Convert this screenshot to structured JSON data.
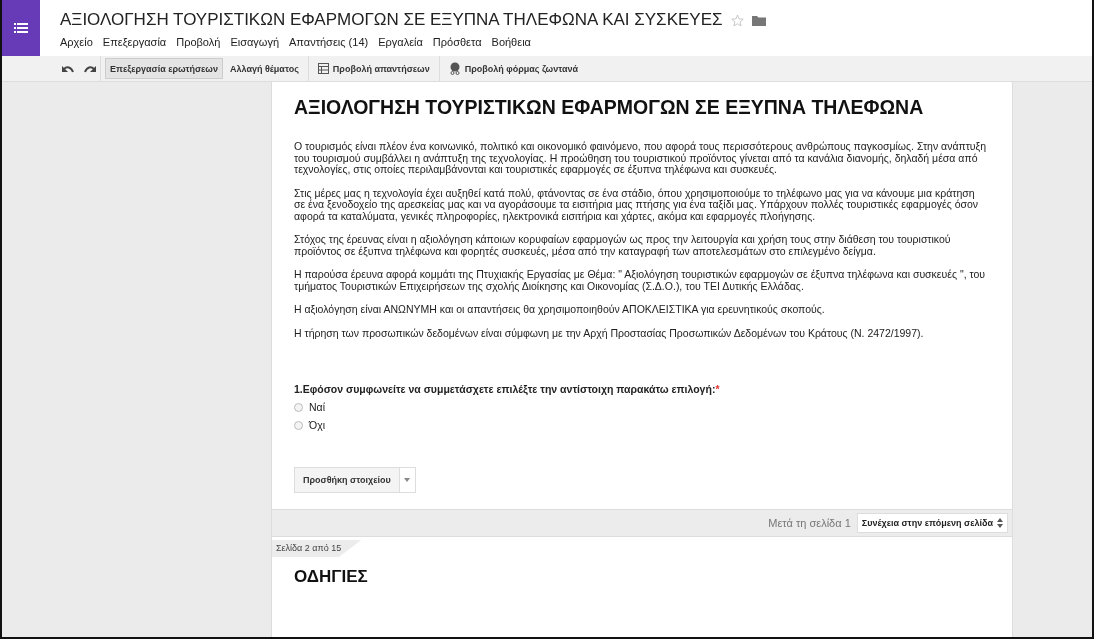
{
  "document": {
    "title": "ΑΞΙΟΛΟΓΗΣΗ ΤΟΥΡΙΣΤΙΚΩΝ ΕΦΑΡΜΟΓΩΝ ΣΕ ΕΞΥΠΝΑ ΤΗΛΕΦΩΝΑ ΚΑΙ ΣΥΣΚΕΥΕΣ",
    "starred": false
  },
  "menu": [
    "Αρχείο",
    "Επεξεργασία",
    "Προβολή",
    "Εισαγωγή",
    "Απαντήσεις (14)",
    "Εργαλεία",
    "Πρόσθετα",
    "Βοήθεια"
  ],
  "toolbar": [
    {
      "kind": "toggle",
      "label": "Επεξεργασία ερωτήσεων",
      "selected": true
    },
    {
      "kind": "toggle",
      "label": "Αλλαγή θέματος",
      "selected": false
    },
    {
      "kind": "table",
      "label": "Προβολή απαντήσεων",
      "selected": false
    },
    {
      "kind": "live",
      "label": "Προβολή φόρμας ζωντανά",
      "selected": false
    }
  ],
  "form": {
    "heading": "ΑΞΙΟΛΟΓΗΣΗ ΤΟΥΡΙΣΤΙΚΩΝ ΕΦΑΡΜΟΓΩΝ ΣΕ ΕΞΥΠΝΑ ΤΗΛΕΦΩΝΑ",
    "paragraphs": [
      "Ο τουρισμός είναι πλέον ένα κοινωνικό, πολιτικό και οικονομικό φαινόμενο, που αφορά τους περισσότερους ανθρώπους παγκοσμίως. Στην ανάπτυξη του τουρισμού συμβάλλει η ανάπτυξη της τεχνολογίας. Η προώθηση του τουριστικού προϊόντος γίνεται από τα κανάλια διανομής, δηλαδή μέσα από τεχνολογίες, στις οποίες περιλαμβάνονται και τουριστικές εφαρμογές σε έξυπνα τηλέφωνα και συσκευές.",
      "Στις μέρες μας η τεχνολογία έχει αυξηθεί κατά πολύ, φτάνοντας σε ένα στάδιο, όπου χρησιμοποιούμε το τηλέφωνο μας για να κάνουμε μια κράτηση σε ένα ξενοδοχείο της αρεσκείας μας και να αγοράσουμε τα εισιτήρια μας πτήσης για ένα ταξίδι μας. Υπάρχουν πολλές τουριστικές εφαρμογές όσον αφορά τα καταλύματα, γενικές πληροφορίες, ηλεκτρονικά εισιτήρια και χάρτες, ακόμα και εφαρμογές πλοήγησης.",
      "Στόχος της έρευνας είναι η αξιολόγηση κάποιων κορυφαίων εφαρμογών ως προς την λειτουργία και χρήση τους στην διάθεση του τουριστικού προϊόντος σε έξυπνα τηλέφωνα και φορητές συσκευές, μέσα από την καταγραφή των αποτελεσμάτων στο επιλεγμένο δείγμα.",
      "Η παρούσα έρευνα αφορά κομμάτι της Πτυχιακής Εργασίας με Θέμα: \" Αξιολόγηση τουριστικών εφαρμογών σε έξυπνα τηλέφωνα και συσκευές \", του τμήματος Τουριστικών Επιχειρήσεων της σχολής  Διοίκησης και Οικονομίας (Σ.Δ.Ο.), του ΤΕΙ Δυτικής Ελλάδας.",
      "Η αξιολόγηση είναι ΑΝΩΝΥΜΗ και οι απαντήσεις θα χρησιμοποιηθούν ΑΠΟΚΛΕΙΣΤΙΚΑ για ερευνητικούς σκοπούς.",
      "Η τήρηση των προσωπικών δεδομένων είναι σύμφωνη με την Αρχή Προστασίας Προσωπικών Δεδομένων του Κράτους (Ν. 2472/1997)."
    ],
    "question": {
      "text": "1.Εφόσον συμφωνείτε να συμμετάσχετε επιλέξτε την αντίστοιχη παρακάτω επιλογή:",
      "required_mark": "*",
      "options": [
        {
          "label": "Ναί",
          "selected": false
        },
        {
          "label": "Όχι",
          "selected": false
        }
      ]
    },
    "add_item_button": "Προσθήκη στοιχείου",
    "page_break": {
      "label": "Μετά τη σελίδα 1",
      "select": "Συνέχεια στην επόμενη σελίδα"
    },
    "next_page": {
      "tab": "Σελίδα 2 από 15",
      "heading": "ΟΔΗΓΙΕΣ"
    }
  }
}
